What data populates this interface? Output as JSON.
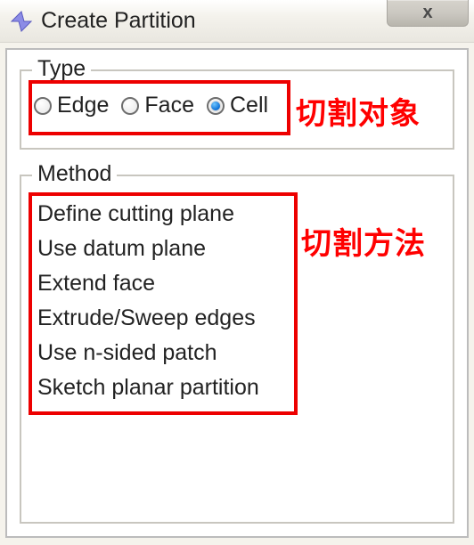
{
  "window": {
    "title": "Create Partition",
    "close_label": "x"
  },
  "type_group": {
    "legend": "Type",
    "options": [
      {
        "label": "Edge",
        "checked": false
      },
      {
        "label": "Face",
        "checked": false
      },
      {
        "label": "Cell",
        "checked": true
      }
    ],
    "annotation": "切割对象"
  },
  "method_group": {
    "legend": "Method",
    "items": [
      "Define cutting plane",
      "Use datum plane",
      "Extend face",
      "Extrude/Sweep edges",
      "Use n-sided patch",
      "Sketch planar partition"
    ],
    "annotation": "切割方法"
  }
}
